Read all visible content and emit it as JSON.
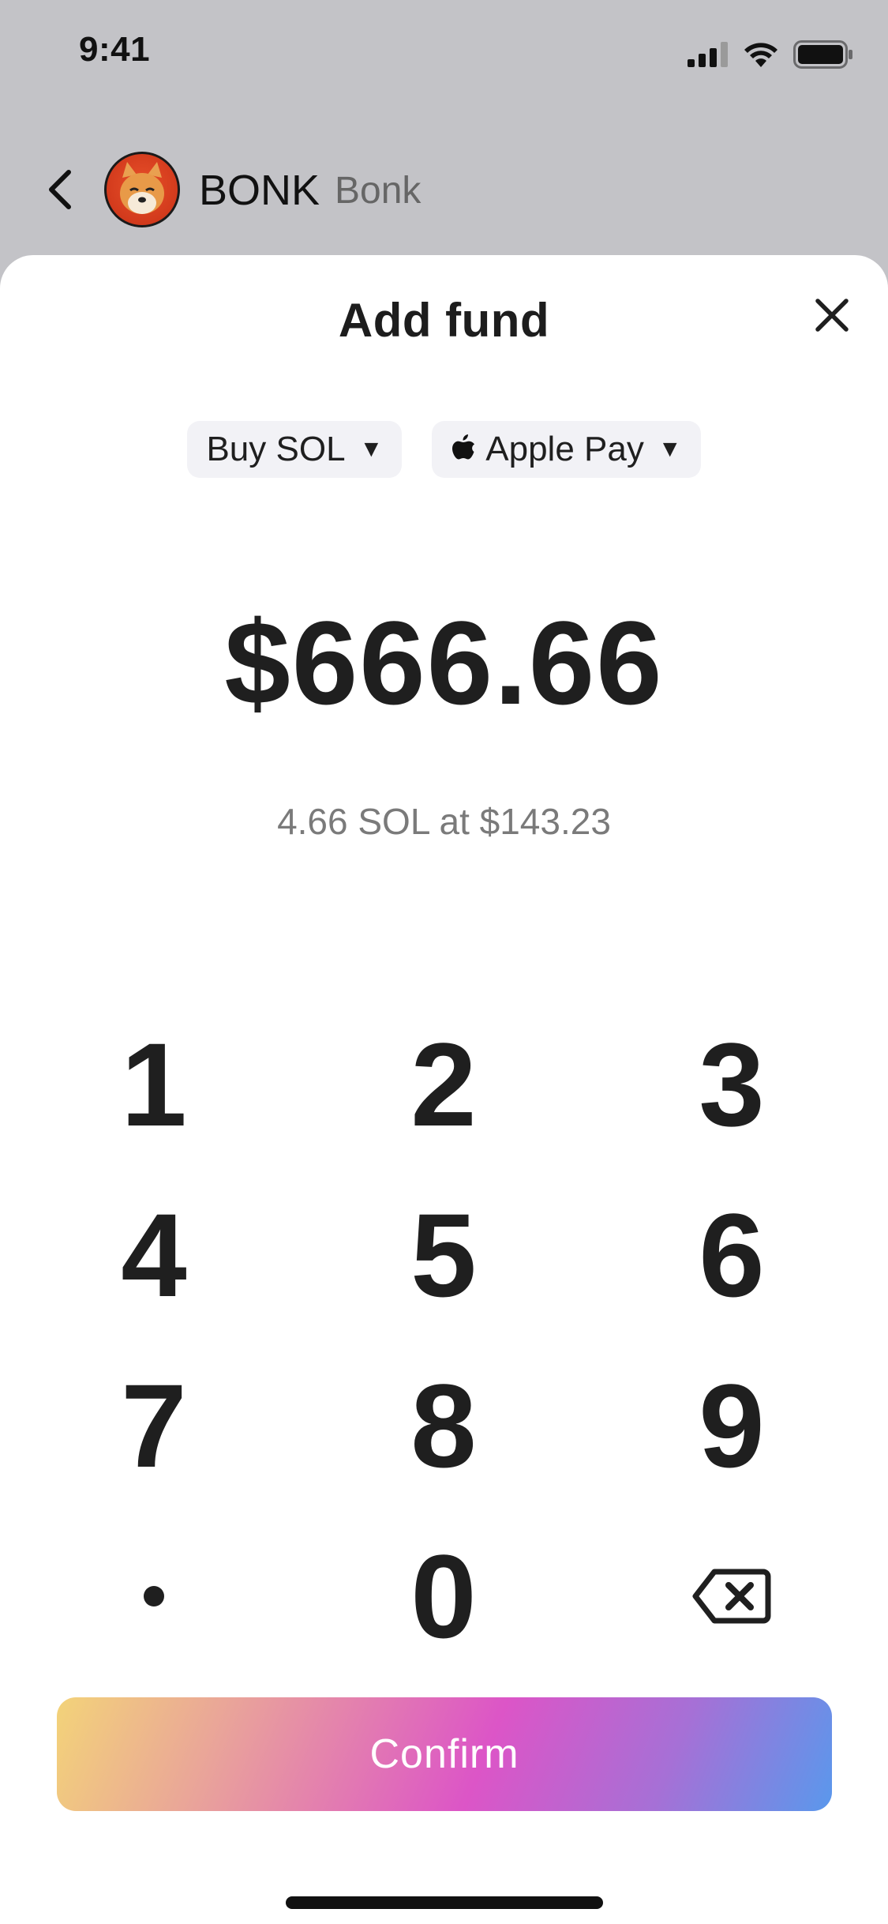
{
  "status_bar": {
    "time": "9:41",
    "icons": [
      "cellular-signal-icon",
      "wifi-icon",
      "battery-icon"
    ]
  },
  "header": {
    "token_symbol": "BONK",
    "token_name": "Bonk",
    "avatar": "bonk-dog-avatar"
  },
  "sheet": {
    "title": "Add fund",
    "pills": {
      "buy_label": "Buy SOL",
      "pay_label": "Apple Pay",
      "caret": "▼"
    },
    "amount": "$666.66",
    "conversion": "4.66 SOL at $143.23"
  },
  "keypad": {
    "keys": [
      "1",
      "2",
      "3",
      "4",
      "5",
      "6",
      "7",
      "8",
      "9",
      "•",
      "0"
    ]
  },
  "confirm": {
    "label": "Confirm"
  },
  "colors": {
    "background_dim": "#c3c3c7",
    "sheet": "#ffffff",
    "pill": "#f2f2f6",
    "text": "#1f1f1f",
    "muted": "#7a7a7a",
    "gradient": [
      "#f3d379",
      "#e9a39a",
      "#dc55c7",
      "#a670d6",
      "#5a98ec"
    ]
  }
}
